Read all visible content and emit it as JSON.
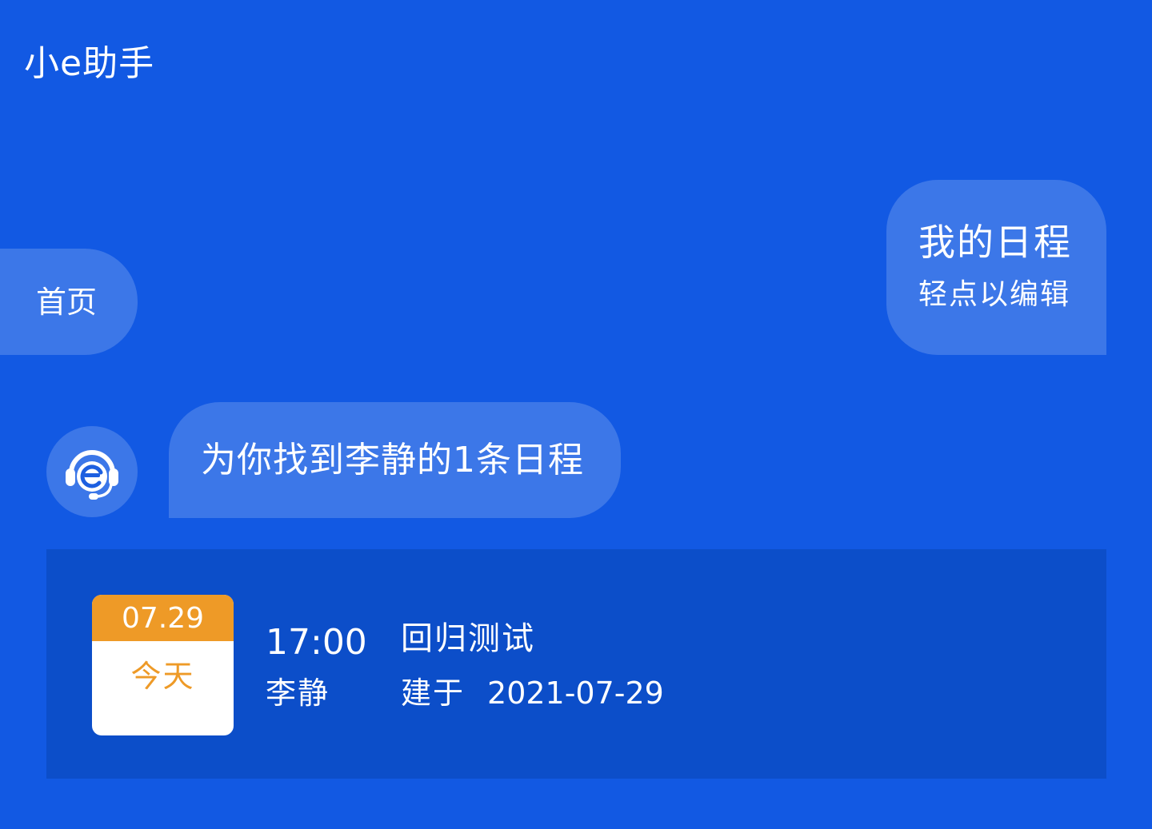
{
  "header": {
    "title": "小e助手"
  },
  "chips": {
    "home_label": "首页"
  },
  "user_message": {
    "query": "我的日程",
    "hint": "轻点以编辑"
  },
  "bot_message": {
    "avatar_icon": "headset-e-icon",
    "text": "为你找到李静的1条日程"
  },
  "schedule": {
    "date": "07.29",
    "day_label": "今天",
    "time": "17:00",
    "owner": "李静",
    "title": "回归测试",
    "created_label": "建于",
    "created_date": "2021-07-29"
  },
  "colors": {
    "background": "#1259e3",
    "card": "#0c4ec9",
    "accent_orange": "#ee9a27",
    "text": "#ffffff"
  }
}
